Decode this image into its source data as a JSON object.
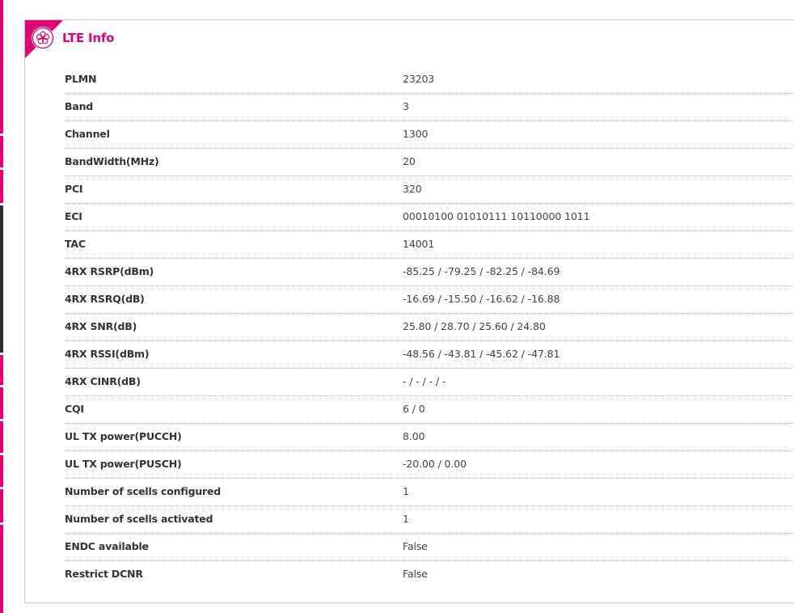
{
  "colors": {
    "accent": "#e20074",
    "rail_dark": "#2b2e2e"
  },
  "panel": {
    "title": "LTE Info",
    "icon": "signal-flower-icon"
  },
  "rows": [
    {
      "label": "PLMN",
      "value": "23203"
    },
    {
      "label": "Band",
      "value": "3"
    },
    {
      "label": "Channel",
      "value": "1300"
    },
    {
      "label": "BandWidth(MHz)",
      "value": "20"
    },
    {
      "label": "PCI",
      "value": "320"
    },
    {
      "label": "ECI",
      "value": "00010100 01010111 10110000 1011"
    },
    {
      "label": "TAC",
      "value": "14001"
    },
    {
      "label": "4RX RSRP(dBm)",
      "value": "-85.25 / -79.25 / -82.25 / -84.69"
    },
    {
      "label": "4RX RSRQ(dB)",
      "value": "-16.69 / -15.50 / -16.62 / -16.88"
    },
    {
      "label": "4RX SNR(dB)",
      "value": "25.80 / 28.70 / 25.60 / 24.80"
    },
    {
      "label": "4RX RSSI(dBm)",
      "value": "-48.56 / -43.81 / -45.62 / -47.81"
    },
    {
      "label": "4RX CINR(dB)",
      "value": "- / - / - / -"
    },
    {
      "label": "CQI",
      "value": "6 / 0"
    },
    {
      "label": "UL TX power(PUCCH)",
      "value": "8.00"
    },
    {
      "label": "UL TX power(PUSCH)",
      "value": "-20.00 / 0.00"
    },
    {
      "label": "Number of scells configured",
      "value": "1"
    },
    {
      "label": "Number of scells activated",
      "value": "1"
    },
    {
      "label": "ENDC available",
      "value": "False"
    },
    {
      "label": "Restrict DCNR",
      "value": "False"
    }
  ]
}
